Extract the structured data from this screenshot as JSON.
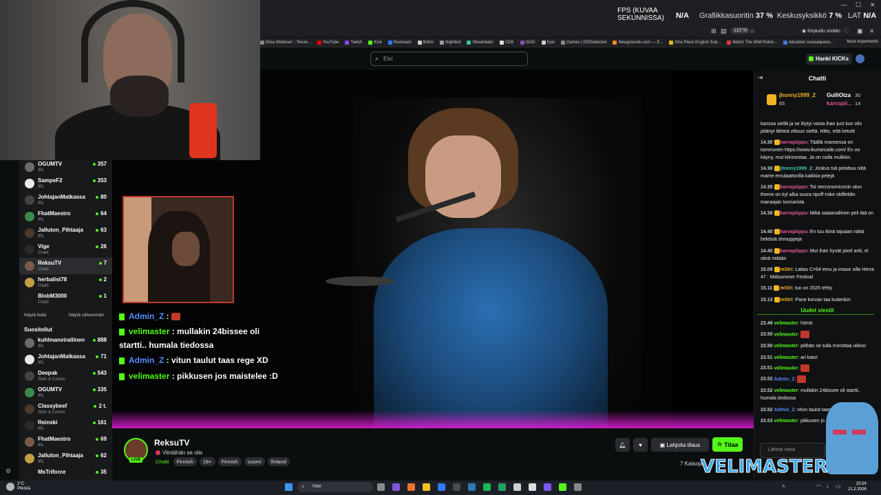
{
  "os_bar": {
    "fps_label_line1": "FPS (KUVAA",
    "fps_label_line2": "SEKUNNISSA)",
    "fps_value": "N/A",
    "gpu_label": "Grafiikkasuoritin",
    "gpu_value": "37 %",
    "cpu_label": "Keskusyksikkö",
    "cpu_value": "7 %",
    "lat_label": "LAT",
    "lat_value": "N/A"
  },
  "browser": {
    "zoom": "110 %",
    "signin_label": "Kirjaudu sisään",
    "bookmarks": [
      {
        "label": "Elisa Webmail :: Tervet...",
        "color": "#888888"
      },
      {
        "label": "YouTube",
        "color": "#ff0000"
      },
      {
        "label": "Twitch",
        "color": "#9146ff"
      },
      {
        "label": "Kick",
        "color": "#53fc18"
      },
      {
        "label": "Restream",
        "color": "#2d7cf6"
      },
      {
        "label": "Botrix",
        "color": "#cccccc"
      },
      {
        "label": "Nightbot",
        "color": "#999999"
      },
      {
        "label": "Streamlabs",
        "color": "#31c3a2"
      },
      {
        "label": "CDK",
        "color": "#dddddd"
      },
      {
        "label": "GOG",
        "color": "#8b4fb6"
      },
      {
        "label": "Epic",
        "color": "#cccccc"
      },
      {
        "label": "Games | DEIDetected",
        "color": "#888888"
      },
      {
        "label": "Newgrounds.com — E...",
        "color": "#f28a1e"
      },
      {
        "label": "One Piece English Sub...",
        "color": "#e6b422"
      },
      {
        "label": "Watch The Wild Robot...",
        "color": "#e03a3a"
      },
      {
        "label": "Aikuisten sosiaalipalve...",
        "color": "#3a7ad0"
      }
    ],
    "bookmarks_more": "Muut kirjanmerkit"
  },
  "site": {
    "search_placeholder": "Etsi",
    "kicks_button": "Hanki KICKs"
  },
  "sidebar": {
    "channels": [
      {
        "name": "OGUMTV",
        "category": "IRL",
        "viewers": "357"
      },
      {
        "name": "SampeF2",
        "category": "IRL",
        "viewers": "353"
      },
      {
        "name": "JohtajanMatkassa",
        "category": "IRL",
        "viewers": "80"
      },
      {
        "name": "FhatMaestro",
        "category": "IRL",
        "viewers": "64"
      },
      {
        "name": "Jalluton_Pihtaaja",
        "category": "IRL",
        "viewers": "63"
      },
      {
        "name": "Vige",
        "category": "Chatti",
        "viewers": "26"
      },
      {
        "name": "ReksuTV",
        "category": "Chatti",
        "viewers": "7"
      },
      {
        "name": "herbalist78",
        "category": "Chatti",
        "viewers": "2"
      },
      {
        "name": "BlobM3000",
        "category": "Chatti",
        "viewers": "1"
      }
    ],
    "show_more": "Näytä lisää",
    "show_less": "Näytä vähemmän",
    "recommended_title": "Suositellut",
    "recommended": [
      {
        "name": "kuhlmanvirallinen",
        "category": "IRL",
        "viewers": "888"
      },
      {
        "name": "JohtajanMatkassa",
        "category": "IRL",
        "viewers": "71"
      },
      {
        "name": "Deepak",
        "category": "Slots & Casino",
        "viewers": "543"
      },
      {
        "name": "OGUMTV",
        "category": "IRL",
        "viewers": "335"
      },
      {
        "name": "Classybeef",
        "category": "Slots & Casino",
        "viewers": "2 t."
      },
      {
        "name": "Reinski",
        "category": "IRL",
        "viewers": "161"
      },
      {
        "name": "FhatMaestro",
        "category": "IRL",
        "viewers": "69"
      },
      {
        "name": "Jalluton_Pihtaaja",
        "category": "IRL",
        "viewers": "62"
      },
      {
        "name": "MsTriforce",
        "category": "",
        "viewers": "35"
      }
    ]
  },
  "video_overlay": {
    "lines": [
      {
        "user": "Admin_Z",
        "sep": " : ",
        "text": ""
      },
      {
        "user": "velimaster",
        "sep": " : ",
        "text": "mullakin 24bissee oli"
      },
      {
        "user": "",
        "sep": "",
        "text": "startti.. humala tiedossa"
      },
      {
        "user": "Admin_Z",
        "sep": " : ",
        "text": "vitun taulut taas rege XD"
      },
      {
        "user": "velimaster",
        "sep": " : ",
        "text": "pikkusen jos maistelee :D"
      }
    ]
  },
  "stream": {
    "streamer": "ReksuTV",
    "live_badge": "LIVE",
    "title": "Viintähän se olis",
    "category": "Chatti",
    "tags": [
      "Finnish",
      "18+",
      "Finnish",
      "suomi",
      "finland"
    ],
    "gift_button": "Lahjoita tilaus",
    "subscribe_button": "Tilaa",
    "watching": "7 Katsojaa"
  },
  "chat": {
    "title": "Chatti",
    "top_gifters": [
      {
        "name": "jhonny1999_2",
        "count": "65"
      },
      {
        "name": "GulliOtza",
        "count": "30"
      },
      {
        "name": "karvapii...",
        "count": "14"
      }
    ],
    "messages": [
      {
        "time": "",
        "user": "",
        "text": "kanssa siellä ja se löytyi vasta ihan just kun olis pitänyt lähteä vittuun sieltä. Hitto, että ketutti"
      },
      {
        "time": "14.30",
        "user": "karvapiippu",
        "text": "Täällä mansessa on tommonen https://www.ikuriarcade.com/ En oo käyny, mut kiinnostaa. Ja on nolla mulkkin."
      },
      {
        "time": "14.30",
        "user": "jhonny1999_2",
        "text": "Joskus tuli pelattua niitä mame emulaattorilla kaikkia pelejä"
      },
      {
        "time": "14.35",
        "user": "karvapiippu",
        "text": "Toi necronomiconin alun theme on kyl alka suora ripoff mike oldfieldin manaajan tunnarista"
      },
      {
        "time": "14.38",
        "user": "karvapiippu",
        "text": "Mikä saatanallinen peli tää on"
      },
      {
        "time": "14.40",
        "user": "karvapiippu",
        "text": "En tuu ikinä tajuaan näitä hektisiä shmuppeja"
      },
      {
        "time": "14.40",
        "user": "karvapiippu",
        "text": "Mut ihan hyvät pixel artit, ei siinä mitään"
      },
      {
        "time": "15.09",
        "user": "mStri",
        "text": "Laitas C=64 emu ja imase sille Herra 47 : Midsummer Festival"
      },
      {
        "time": "15.11",
        "user": "mStri",
        "text": "tuo on 2025 tehty"
      },
      {
        "time": "15.13",
        "user": "mStri",
        "text": "Pane korvan taa kuitenkin"
      }
    ],
    "new_messages_label": "Uudet viestit",
    "new_messages": [
      {
        "time": "23.49",
        "user": "velimaster",
        "text": "hömö"
      },
      {
        "time": "23.50",
        "user": "velimaster",
        "text": ""
      },
      {
        "time": "23.50",
        "user": "velimaster",
        "text": "pitihän se tulla morottaa ukkoo"
      },
      {
        "time": "23.51",
        "user": "velimaster",
        "text": "ari kato!"
      },
      {
        "time": "23.51",
        "user": "velimaster",
        "text": ""
      },
      {
        "time": "23.52",
        "user": "Admin_Z",
        "text": ""
      },
      {
        "time": "23.52",
        "user": "velimaster",
        "text": "mullakin 24bissee oli startti.. humala tiedossa"
      },
      {
        "time": "23.52",
        "user": "Admin_Z",
        "text": "vitun taulut taas"
      },
      {
        "time": "23.53",
        "user": "velimaster",
        "text": "pikkusen jo"
      }
    ],
    "input_placeholder": "Lähetä viesti"
  },
  "overlay_logo": "VELIMASTER",
  "taskbar": {
    "weather_temp": "2°C",
    "weather_desc": "Pilvistä",
    "search_placeholder": "Hae",
    "time": "23.54",
    "date": "21.2.2026"
  },
  "colors": {
    "kick_green": "#53fc18",
    "pink_user": "#e2559b",
    "blue_user": "#5a8cff"
  }
}
